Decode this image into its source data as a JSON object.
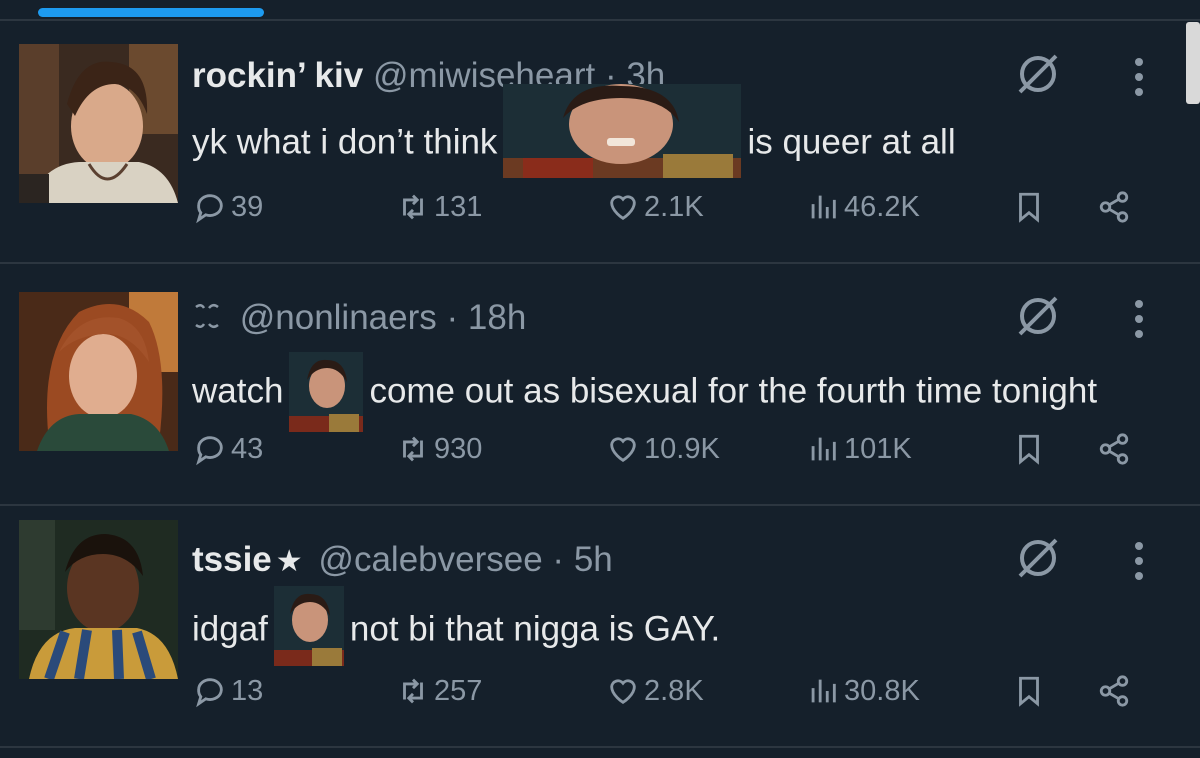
{
  "posts": [
    {
      "name": "rockin’ kiv",
      "handle": "@miwiseheart",
      "separator": "·",
      "time": "3h",
      "text_before": "yk what i don’t think",
      "text_after": "is queer at all",
      "stats": {
        "replies": "39",
        "reposts": "131",
        "likes": "2.1K",
        "views": "46.2K"
      }
    },
    {
      "name": "",
      "handle": "@nonlinaers",
      "separator": "·",
      "time": "18h",
      "text_before": "watch",
      "text_after": "come out as bisexual for the fourth time tonight",
      "stats": {
        "replies": "43",
        "reposts": "930",
        "likes": "10.9K",
        "views": "101K"
      }
    },
    {
      "name": "tssie",
      "badge": "★",
      "handle": "@calebversee",
      "separator": "·",
      "time": "5h",
      "text_before": "idgaf",
      "text_after": "not bi that nigga is GAY.",
      "stats": {
        "replies": "13",
        "reposts": "257",
        "likes": "2.8K",
        "views": "30.8K"
      }
    }
  ],
  "icons": {
    "reply": "reply-icon",
    "repost": "repost-icon",
    "like": "heart-icon",
    "views": "views-icon",
    "bookmark": "bookmark-icon",
    "share": "share-icon",
    "grok": "grok-icon",
    "more": "more-icon"
  },
  "colors": {
    "background": "#15202b",
    "text": "#e7e9ea",
    "secondary": "#8b98a5",
    "accent": "#1d9bf0",
    "divider": "#2c3640"
  }
}
